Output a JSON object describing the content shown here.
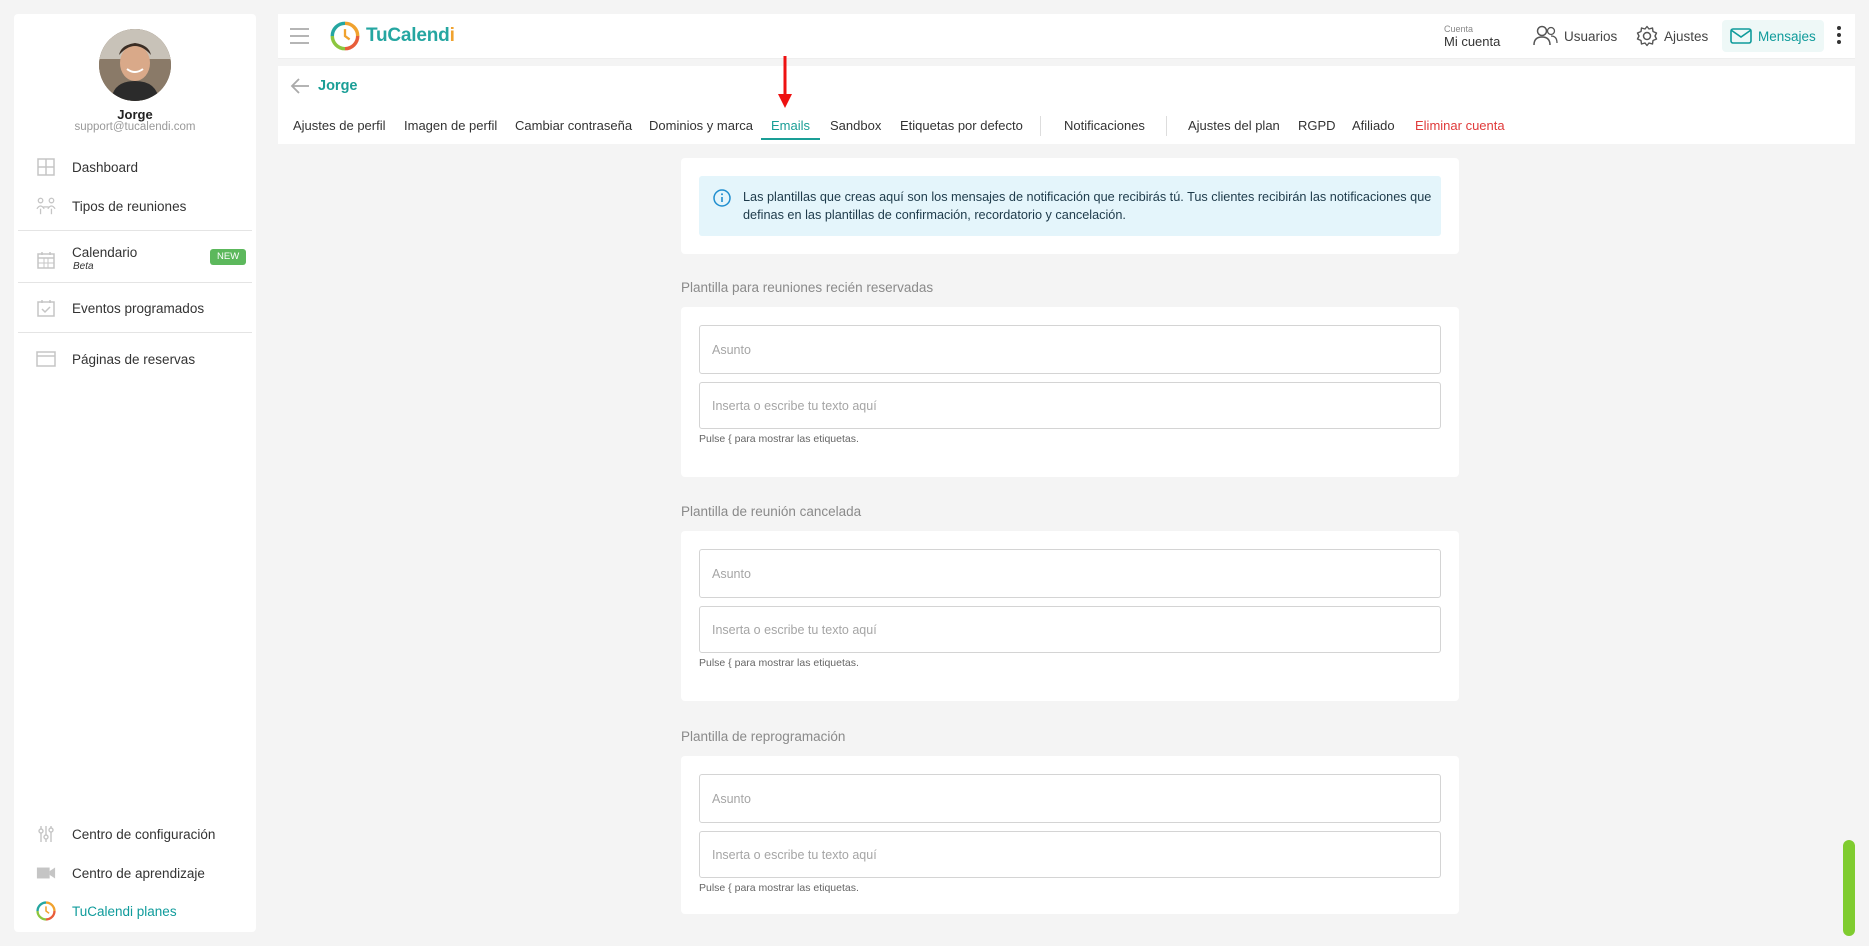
{
  "sidebar": {
    "user_name": "Jorge",
    "user_email": "support@tucalendi.com",
    "items": [
      {
        "label": "Dashboard",
        "icon": "dashboard-icon"
      },
      {
        "label": "Tipos de reuniones",
        "icon": "meeting-types-icon"
      },
      {
        "label": "Calendario",
        "sub": "Beta",
        "badge": "NEW",
        "icon": "calendar-icon"
      },
      {
        "label": "Eventos programados",
        "icon": "scheduled-events-icon"
      },
      {
        "label": "Páginas de reservas",
        "icon": "booking-pages-icon"
      }
    ],
    "bottom_items": [
      {
        "label": "Centro de configuración",
        "icon": "sliders-icon"
      },
      {
        "label": "Centro de aprendizaje",
        "icon": "video-camera-icon"
      },
      {
        "label": "TuCalendi planes",
        "icon": "tucalendi-logo-icon"
      }
    ]
  },
  "topbar": {
    "logo_part1": "TuCalend",
    "logo_part2": "i",
    "account_small": "Cuenta",
    "account_name": "Mi cuenta",
    "users": "Usuarios",
    "settings": "Ajustes",
    "messages": "Mensajes"
  },
  "subheader": {
    "back_name": "Jorge",
    "tabs": [
      "Ajustes de perfil",
      "Imagen de perfil",
      "Cambiar contraseña",
      "Dominios y marca",
      "Emails",
      "Sandbox",
      "Etiquetas por defecto",
      "Notificaciones",
      "Ajustes del plan",
      "RGPD",
      "Afiliado",
      "Eliminar cuenta"
    ],
    "active_tab": "Emails"
  },
  "info": {
    "text": "Las plantillas que creas aquí son los mensajes de notificación que recibirás tú. Tus clientes recibirán las notificaciones que definas en las plantillas de confirmación, recordatorio y cancelación."
  },
  "templates": [
    {
      "title": "Plantilla para reuniones recién reservadas",
      "subject_placeholder": "Asunto",
      "body_placeholder": "Inserta o escribe tu texto aquí",
      "hint": "Pulse { para mostrar las etiquetas."
    },
    {
      "title": "Plantilla de reunión cancelada",
      "subject_placeholder": "Asunto",
      "body_placeholder": "Inserta o escribe tu texto aquí",
      "hint": "Pulse { para mostrar las etiquetas."
    },
    {
      "title": "Plantilla de reprogramación",
      "subject_placeholder": "Asunto",
      "body_placeholder": "Inserta o escribe tu texto aquí",
      "hint": "Pulse { para mostrar las etiquetas."
    }
  ],
  "colors": {
    "brand_teal": "#1a9e96",
    "brand_orange": "#f0a22e",
    "danger": "#e03a3a",
    "badge_green": "#5cb85c",
    "info_bg": "#e4f5fb"
  }
}
